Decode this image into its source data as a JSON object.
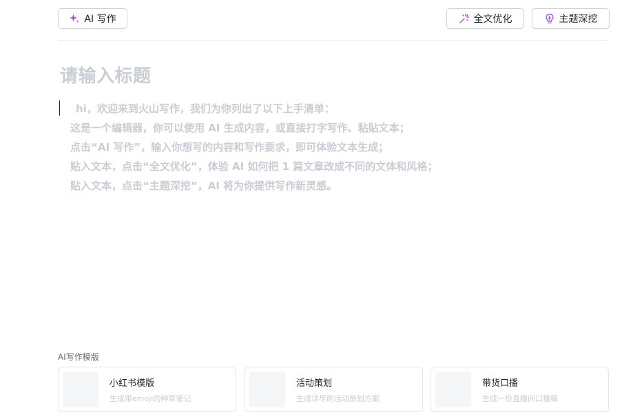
{
  "toolbar": {
    "ai_write": {
      "label": "AI 写作",
      "icon": "sparkle-icon",
      "icon_color": "#b14fd9"
    },
    "optimize": {
      "label": "全文优化",
      "icon": "magic-wand-icon",
      "icon_color": "#b14fd9"
    },
    "topic": {
      "label": "主题深挖",
      "icon": "lightbulb-icon",
      "icon_color": "#b14fd9"
    }
  },
  "editor": {
    "title_placeholder": "请输入标题",
    "body_lines": [
      "hi，欢迎来到火山写作，我们为你列出了以下上手清单：",
      "这是一个编辑器，你可以使用 AI 生成内容，或直接打字写作、粘贴文本；",
      "点击“AI 写作”，输入你想写的内容和写作要求，即可体验文本生成；",
      "贴入文本，点击“全文优化”，体验 AI 如何把 1 篇文章改成不同的文体和风格；",
      "贴入文本，点击“主题深挖”，AI 将为你提供写作新灵感。"
    ]
  },
  "templates": {
    "section_label": "AI写作模版",
    "items": [
      {
        "name": "小红书模版",
        "desc": "生成带emoji的种草笔记"
      },
      {
        "name": "活动策划",
        "desc": "生成详尽的活动策划方案"
      },
      {
        "name": "带货口播",
        "desc": "生成一份直播间口播稿"
      }
    ]
  },
  "colors": {
    "accent": "#b14fd9",
    "placeholder_text": "#c9cdd4",
    "border": "#d0d3d6"
  }
}
